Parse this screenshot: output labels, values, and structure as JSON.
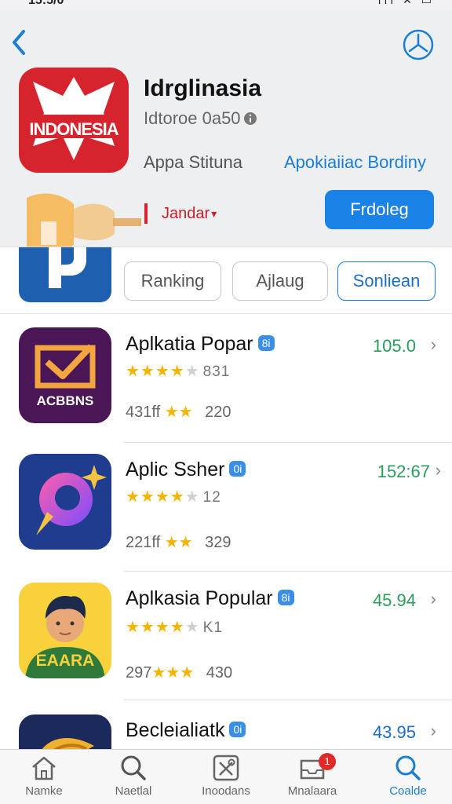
{
  "status_bar": {
    "time": "15:5/0",
    "icons": "ııı ✕ ▭"
  },
  "header": {
    "app_title": "Idrglinasia",
    "app_subtitle": "Idtoroe 0a50",
    "app_category": "Appa Stituna",
    "app_link": "Apokiaiiac Bordiny",
    "icon_text": "INDONESIA",
    "dropdown_label": "Jandar",
    "primary_button": "Frdoleg"
  },
  "tabs": [
    {
      "label": "Ranking"
    },
    {
      "label": "Ajlaug"
    },
    {
      "label": "Sonliean"
    }
  ],
  "apps": [
    {
      "title": "Aplkatia Popar",
      "badge": "8i",
      "price": "105.0",
      "price_color": "#2a9d5c",
      "rating_stars": 4,
      "rating_count": "831",
      "meta_prefix": "431ff",
      "meta_stars": 2,
      "meta_value": "220",
      "icon_text": "ACBBNS"
    },
    {
      "title": "Aplic Ssher",
      "badge": "0i",
      "price": "152:67",
      "price_color": "#2a9d5c",
      "rating_stars": 4,
      "rating_count": "12",
      "meta_prefix": "221ff",
      "meta_stars": 2,
      "meta_value": "329"
    },
    {
      "title": "Aplkasia Popular",
      "badge": "8i",
      "price": "45.94",
      "price_color": "#2a9d5c",
      "rating_stars": 4,
      "rating_count": "K1",
      "meta_prefix": "297",
      "meta_stars": 3,
      "meta_value": "430",
      "icon_text": "EAARA"
    },
    {
      "title": "Becleialiatk",
      "badge": "0i",
      "price": "43.95",
      "price_color": "#1a6fc4"
    }
  ],
  "bottom_tabs": [
    {
      "label": "Namke",
      "icon": "home-icon"
    },
    {
      "label": "Naetlal",
      "icon": "search-icon"
    },
    {
      "label": "Inoodans",
      "icon": "tools-icon"
    },
    {
      "label": "Mnalaara",
      "icon": "inbox-icon",
      "badge": "1"
    },
    {
      "label": "Coalde",
      "icon": "search-icon"
    }
  ]
}
